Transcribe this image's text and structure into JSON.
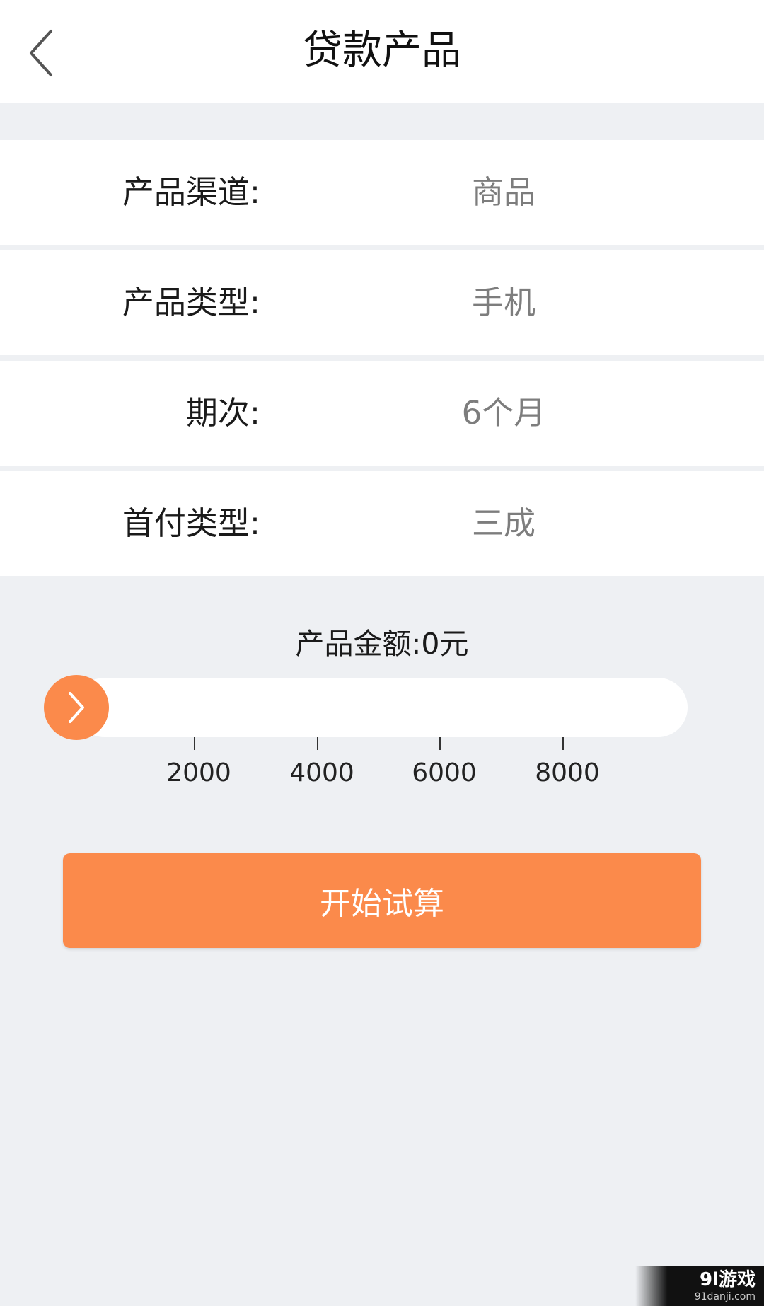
{
  "header": {
    "title": "贷款产品",
    "back_icon": "chevron-left-icon"
  },
  "rows": [
    {
      "label": "产品渠道:",
      "value": "商品"
    },
    {
      "label": "产品类型:",
      "value": "手机"
    },
    {
      "label": "期次:",
      "value": "6个月"
    },
    {
      "label": "首付类型:",
      "value": "三成"
    }
  ],
  "amount": {
    "label": "产品金额:0元",
    "value": 0,
    "min": 0,
    "max": 10000,
    "ticks": [
      "2000",
      "4000",
      "6000",
      "8000"
    ],
    "thumb_icon": "chevron-right-icon"
  },
  "calc_button": {
    "label": "开始试算"
  },
  "watermark": {
    "logo": "9l游戏",
    "url": "91danji.com"
  },
  "colors": {
    "accent": "#fb8a4b",
    "background": "#eef0f3",
    "value_text": "#7d7d7d"
  }
}
